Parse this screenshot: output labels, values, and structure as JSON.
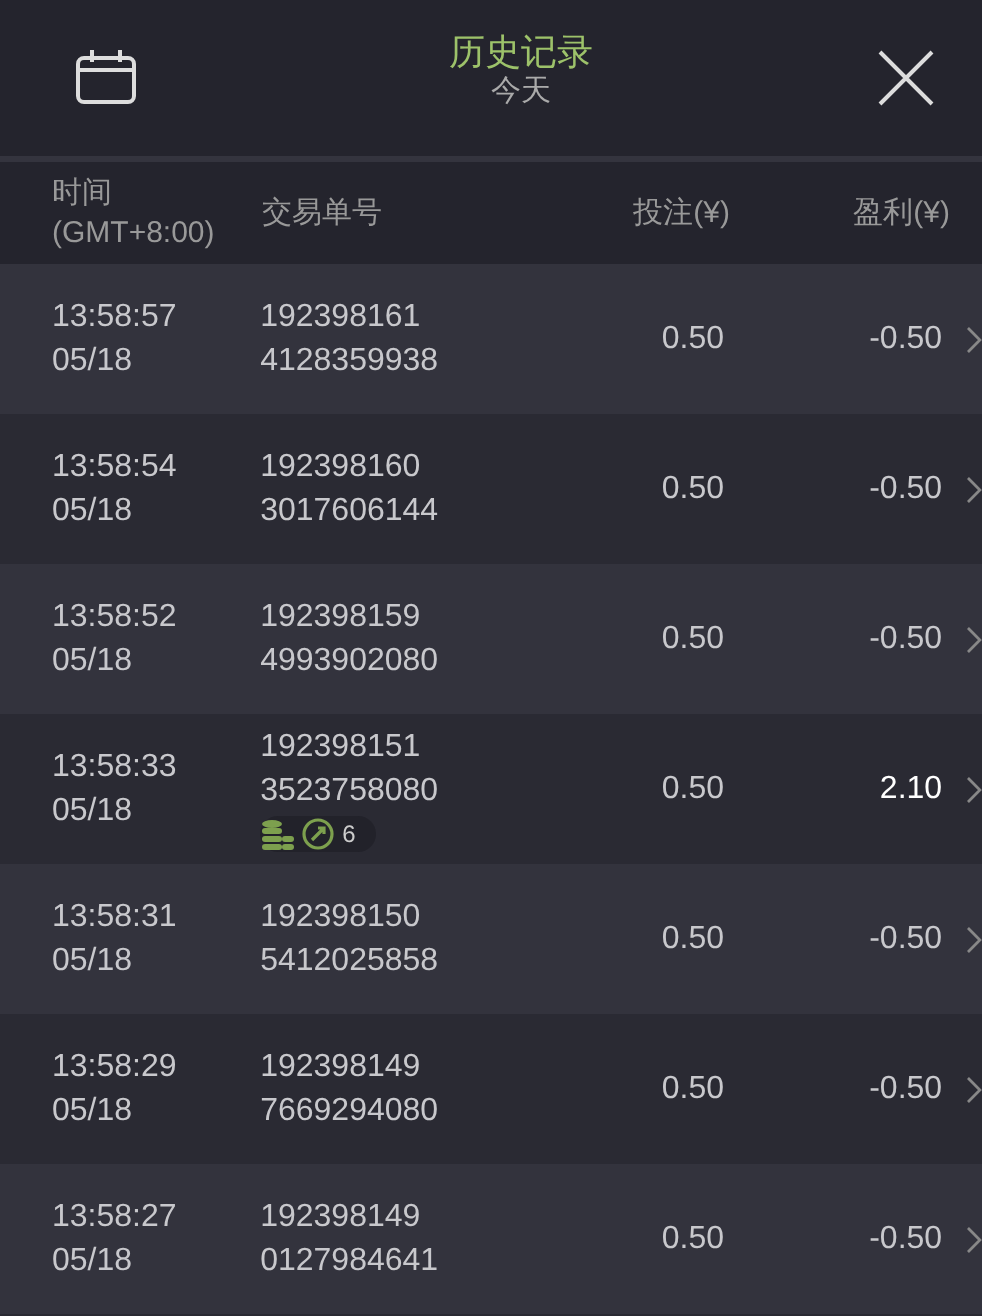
{
  "header": {
    "title": "历史记录",
    "subtitle": "今天"
  },
  "columns": [
    "时间\n(GMT+8:00)",
    "交易单号",
    "投注(¥)",
    "盈利(¥)"
  ],
  "rows": [
    {
      "time": "13:58:57",
      "date": "05/18",
      "id_1": "192398161",
      "id_2": "4128359938",
      "stake": "0.50",
      "profit": "-0.50",
      "win": false
    },
    {
      "time": "13:58:54",
      "date": "05/18",
      "id_1": "192398160",
      "id_2": "3017606144",
      "stake": "0.50",
      "profit": "-0.50",
      "win": false
    },
    {
      "time": "13:58:52",
      "date": "05/18",
      "id_1": "192398159",
      "id_2": "4993902080",
      "stake": "0.50",
      "profit": "-0.50",
      "win": false
    },
    {
      "time": "13:58:33",
      "date": "05/18",
      "id_1": "192398151",
      "id_2": "3523758080",
      "stake": "0.50",
      "profit": "2.10",
      "win": true,
      "badge": {
        "count": "6"
      }
    },
    {
      "time": "13:58:31",
      "date": "05/18",
      "id_1": "192398150",
      "id_2": "5412025858",
      "stake": "0.50",
      "profit": "-0.50",
      "win": false
    },
    {
      "time": "13:58:29",
      "date": "05/18",
      "id_1": "192398149",
      "id_2": "7669294080",
      "stake": "0.50",
      "profit": "-0.50",
      "win": false
    },
    {
      "time": "13:58:27",
      "date": "05/18",
      "id_1": "192398149",
      "id_2": "0127984641",
      "stake": "0.50",
      "profit": "-0.50",
      "win": false
    }
  ]
}
